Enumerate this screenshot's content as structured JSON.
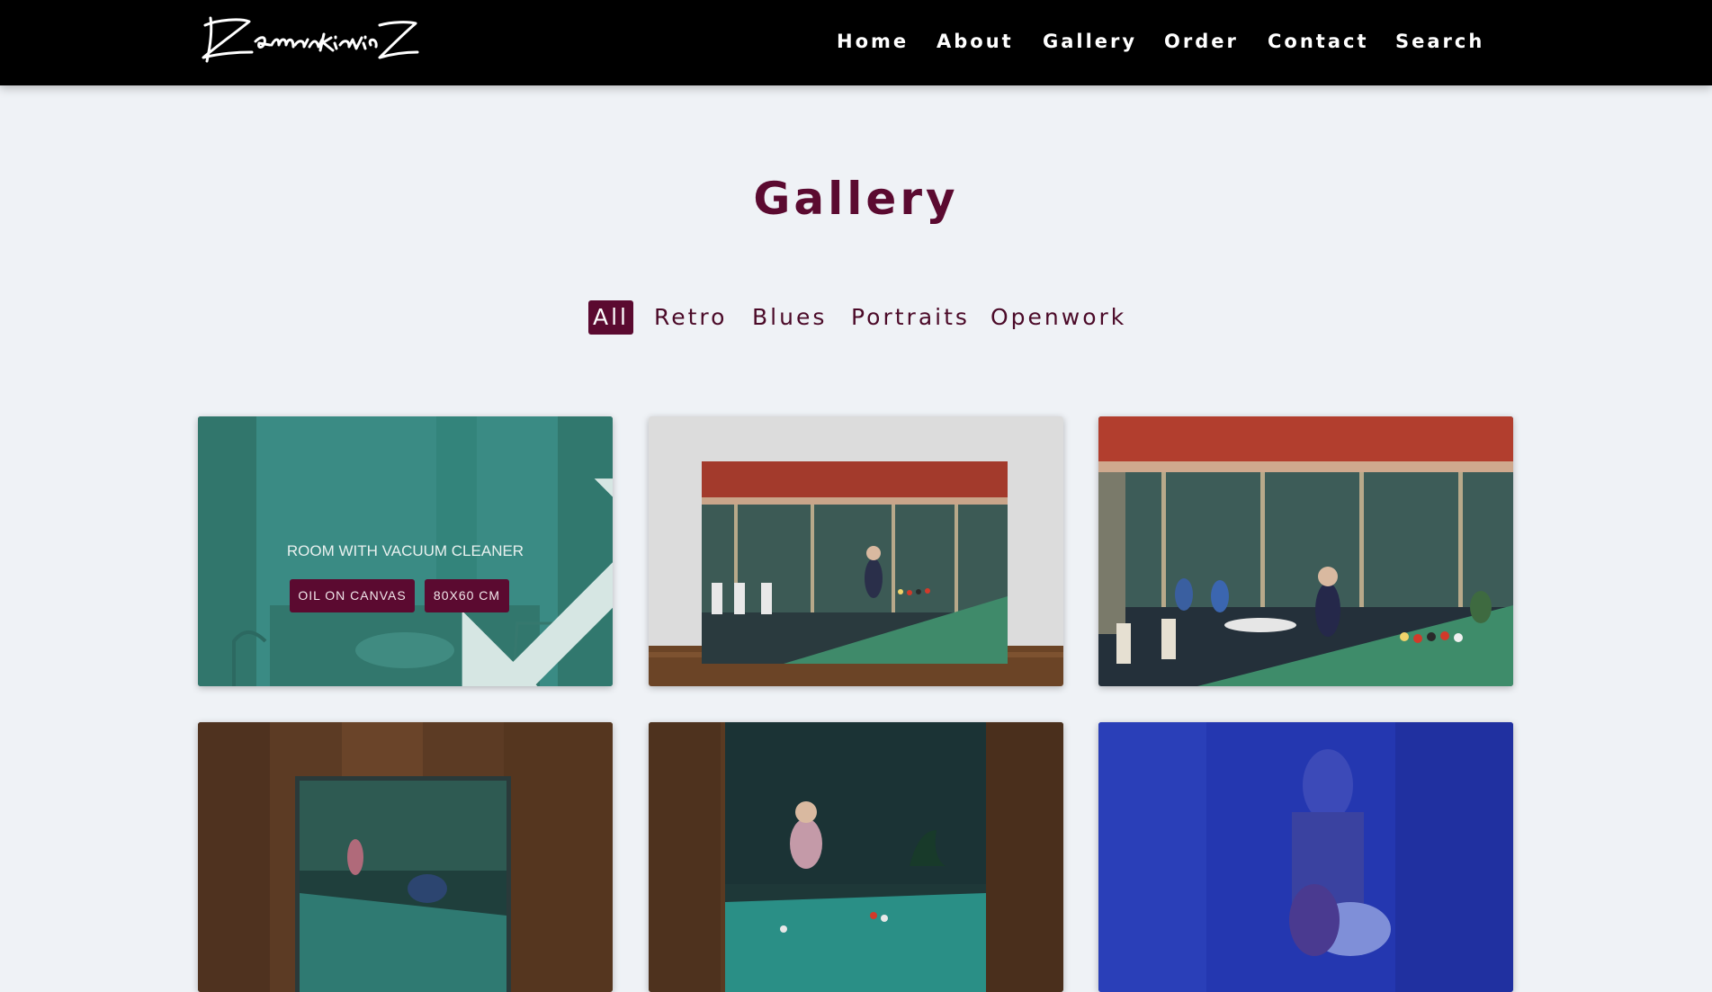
{
  "header": {
    "logo_text": "ZemanKiewicZ",
    "nav": [
      "Home",
      "About",
      "Gallery",
      "Order",
      "Contact",
      "Search"
    ]
  },
  "page": {
    "title": "Gallery"
  },
  "filters": {
    "items": [
      "All",
      "Retro",
      "Blues",
      "Portraits",
      "Openwork"
    ],
    "active": "All"
  },
  "gallery": {
    "hovered_item": {
      "title": "ROOM WITH VACUUM CLEANER",
      "medium": "OIL ON CANVAS",
      "size": "80X60 CM"
    }
  },
  "colors": {
    "accent": "#5b0a30",
    "header_bg": "#000000",
    "page_bg": "#eff2f6"
  },
  "icons": {
    "expand": "expand-arrows-icon"
  }
}
